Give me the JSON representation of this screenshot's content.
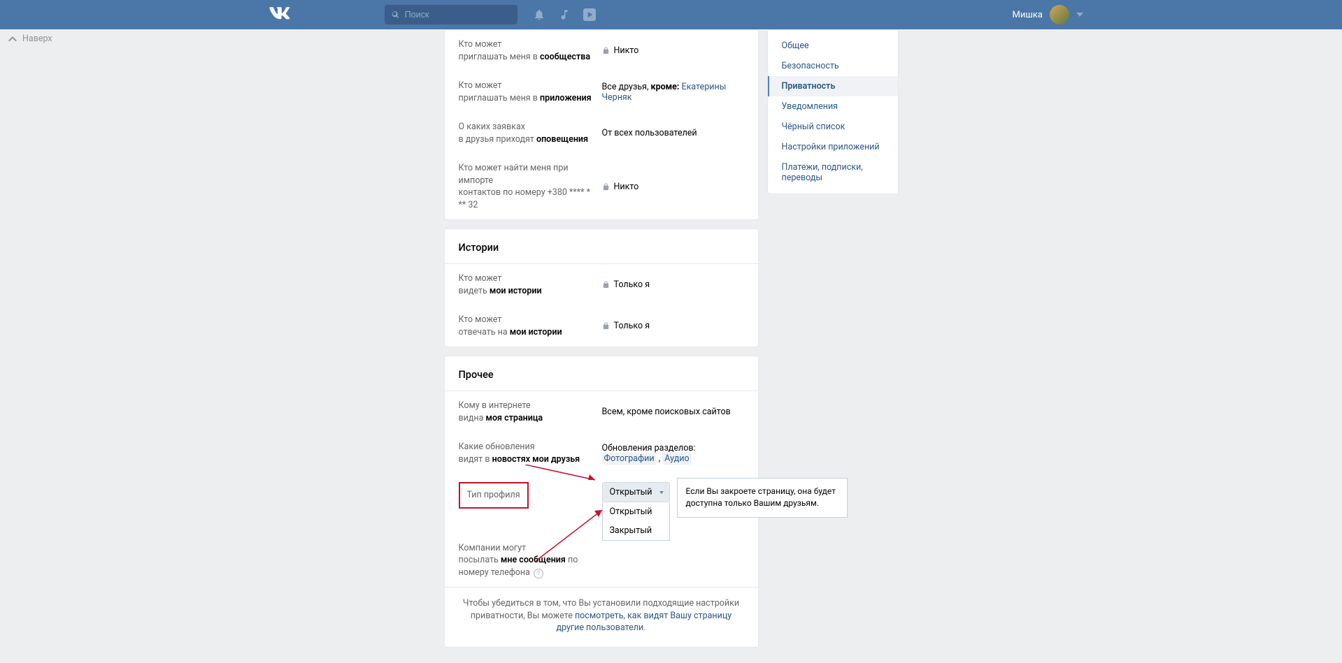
{
  "header": {
    "search_placeholder": "Поиск",
    "username": "Мишка"
  },
  "back_top": "Наверх",
  "sections": {
    "invites": {
      "row1_a": "Кто может",
      "row1_b_plain": "приглашать меня в ",
      "row1_b_bold": "сообщества",
      "row1_val": "Никто",
      "row2_a": "Кто может",
      "row2_b_plain": "приглашать меня в ",
      "row2_b_bold": "приложения",
      "row2_val_pre": "Все друзья, ",
      "row2_val_bold": "кроме:",
      "row2_val_name": "Екатерины Черняк",
      "row3_a": "О каких заявках",
      "row3_b_plain": "в друзья приходят ",
      "row3_b_bold": "оповещения",
      "row3_val": "От всех пользователей",
      "row4_a": "Кто может найти меня при импорте",
      "row4_b": "контактов по номеру +380 **** * ** 32",
      "row4_val": "Никто"
    },
    "stories": {
      "title": "Истории",
      "row1_a": "Кто может",
      "row1_b_plain": "видеть ",
      "row1_b_bold": "мои истории",
      "row1_val": "Только я",
      "row2_a": "Кто может",
      "row2_b_plain": "отвечать на ",
      "row2_b_bold": "мои истории",
      "row2_val": "Только я"
    },
    "other": {
      "title": "Прочее",
      "row1_a": "Кому в интернете",
      "row1_b_plain": "видна ",
      "row1_b_bold": "моя страница",
      "row1_val": "Всем, кроме поисковых сайтов",
      "row2_a": "Какие обновления",
      "row2_b_plain": "видят в ",
      "row2_b_bold": "новостях мои друзья",
      "row2_val_pre": "Обновления разделов: ",
      "row2_tag1": "Фотографии",
      "row2_tag2": "Аудио",
      "profile_type_label": "Тип профиля",
      "profile_type_selected": "Открытый",
      "profile_type_options": [
        "Открытый",
        "Закрытый"
      ],
      "profile_type_tooltip": "Если Вы закроете страницу, она будет доступна только Вашим друзьям.",
      "row4_a": "Компании могут",
      "row4_b_plain": "посылать ",
      "row4_b_bold": "мне сообщения",
      "row4_b_tail": " по номеру телефона",
      "footer_pre": "Чтобы убедиться в том, что Вы установили подходящие настройки приватности, Вы можете ",
      "footer_link": "посмотреть, как видят Вашу страницу другие пользователи"
    }
  },
  "nav": {
    "items": [
      "Общее",
      "Безопасность",
      "Приватность",
      "Уведомления",
      "Чёрный список",
      "Настройки приложений",
      "Платежи, подписки, переводы"
    ],
    "active_index": 2
  }
}
